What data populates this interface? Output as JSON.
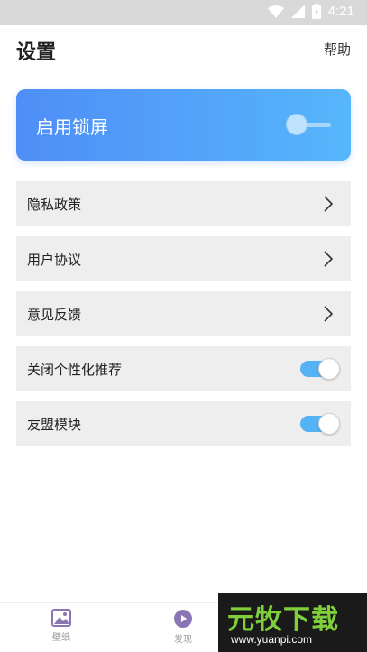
{
  "status_bar": {
    "time": "4:21",
    "icons": [
      "wifi-icon",
      "signal-icon",
      "battery-icon"
    ]
  },
  "header": {
    "title": "设置",
    "help_label": "帮助"
  },
  "lock_card": {
    "label": "启用锁屏",
    "enabled": false
  },
  "settings": [
    {
      "label": "隐私政策",
      "type": "link"
    },
    {
      "label": "用户协议",
      "type": "link"
    },
    {
      "label": "意见反馈",
      "type": "link"
    },
    {
      "label": "关闭个性化推荐",
      "type": "switch",
      "on": true
    },
    {
      "label": "友盟模块",
      "type": "switch",
      "on": true
    }
  ],
  "bottom_nav": {
    "items": [
      {
        "label": "壁纸",
        "icon": "image-icon"
      },
      {
        "label": "发现",
        "icon": "discover-play-icon"
      }
    ]
  },
  "watermark": {
    "title": "元牧下载",
    "url": "www.yuanpi.com"
  },
  "colors": {
    "accent": "#4f8ef7",
    "accent_end": "#56b6fb",
    "switch_on": "#55b3f5",
    "row_bg": "#eeeeee"
  }
}
